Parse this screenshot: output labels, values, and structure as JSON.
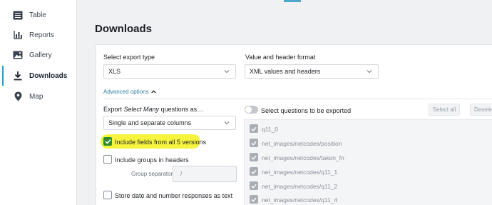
{
  "sidebar": {
    "items": [
      {
        "label": "Table",
        "icon": "table-icon"
      },
      {
        "label": "Reports",
        "icon": "reports-icon"
      },
      {
        "label": "Gallery",
        "icon": "gallery-icon"
      },
      {
        "label": "Downloads",
        "icon": "download-icon",
        "active": true
      },
      {
        "label": "Map",
        "icon": "map-pin-icon"
      }
    ]
  },
  "page": {
    "title": "Downloads"
  },
  "export_type": {
    "label": "Select export type",
    "value": "XLS"
  },
  "format": {
    "label": "Value and header format",
    "value": "XML values and headers"
  },
  "advanced": {
    "label": "Advanced options"
  },
  "select_many": {
    "label_prefix": "Export ",
    "label_em": "Select Many",
    "label_suffix": " questions as…",
    "value": "Single and separate columns"
  },
  "options": {
    "include_fields": "Include fields from all 5 versions",
    "include_groups": "Include groups in headers",
    "group_separator_label": "Group separator",
    "group_separator_value": "/",
    "store_date": "Store date and number responses as text"
  },
  "questions": {
    "toggle_label": "Select questions to be exported",
    "select_all": "Select all",
    "deselect_all": "Deselect all",
    "items": [
      "q11_0",
      "net_images/netcodes/position",
      "net_images/netcodes/taken_fn",
      "net_images/netcodes/q11_1",
      "net_images/netcodes/q11_2",
      "net_images/netcodes/q11_4"
    ]
  },
  "colors": {
    "accent": "#1da1c5",
    "highlight": "#f6f43d",
    "check": "#2e8b2e"
  }
}
